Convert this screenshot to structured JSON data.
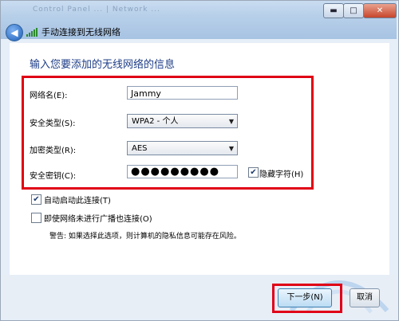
{
  "window": {
    "ghost_tabs": "Control Panel ... | Network ...",
    "title": "手动连接到无线网络",
    "back_glyph": "◀",
    "min_glyph": "▬",
    "max_glyph": "□",
    "close_glyph": "✕"
  },
  "form": {
    "heading": "输入您要添加的无线网络的信息",
    "network_name": {
      "label": "网络名(E):",
      "value": "Jammy"
    },
    "security_type": {
      "label": "安全类型(S):",
      "value": "WPA2 - 个人"
    },
    "encryption_type": {
      "label": "加密类型(R):",
      "value": "AES"
    },
    "security_key": {
      "label": "安全密钥(C):",
      "value": "●●●●●●●●●"
    },
    "hide_chars": {
      "label": "隐藏字符(H)",
      "checked": true
    }
  },
  "options": {
    "auto_start": {
      "label": "自动启动此连接(T)",
      "checked": true
    },
    "connect_hidden": {
      "label": "即使网络未进行广播也连接(O)",
      "checked": false
    },
    "warning": "警告: 如果选择此选项，则计算机的隐私信息可能存在风险。"
  },
  "buttons": {
    "next": "下一步(N)",
    "cancel": "取消"
  },
  "colors": {
    "highlight_red": "#e00016",
    "heading_blue": "#1e3d87"
  }
}
